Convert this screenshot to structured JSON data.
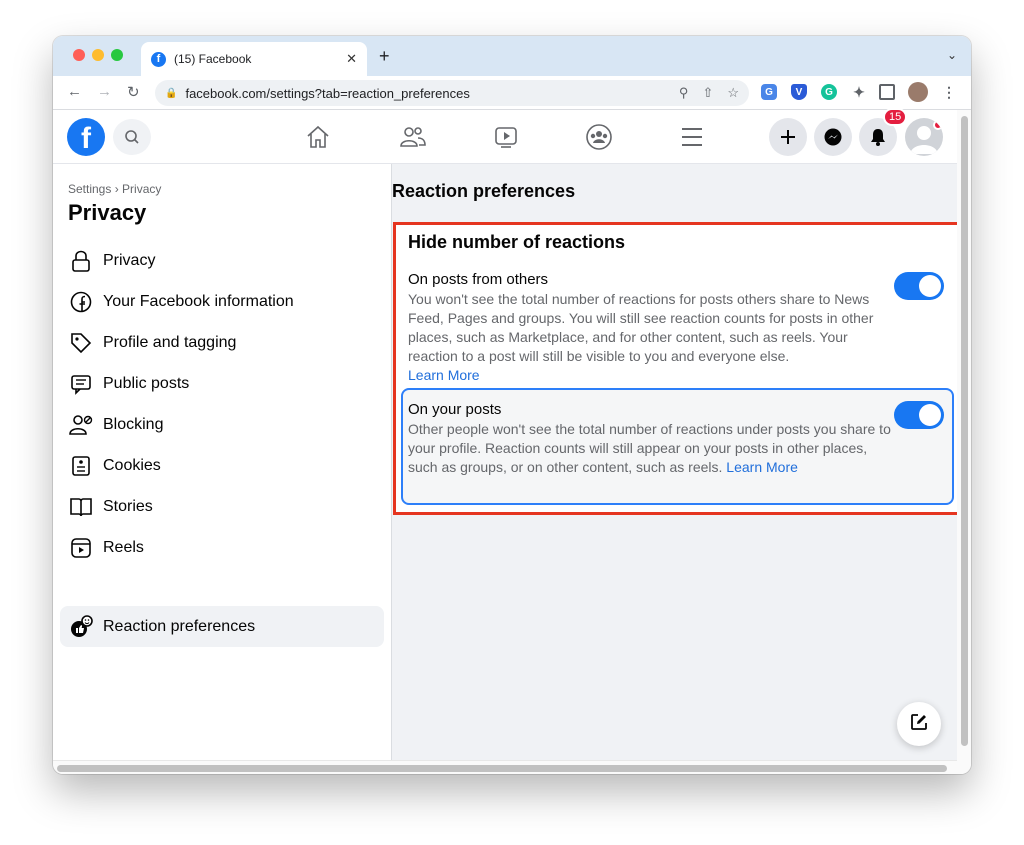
{
  "browser": {
    "tab_title": "(15) Facebook",
    "tab_close": "✕",
    "new_tab": "+",
    "url": "facebook.com/settings?tab=reaction_preferences"
  },
  "header": {
    "logo_letter": "f",
    "notification_count": "15"
  },
  "sidebar": {
    "breadcrumb": "Settings › Privacy",
    "title": "Privacy",
    "items": [
      {
        "label": "Privacy",
        "icon": "lock-icon"
      },
      {
        "label": "Your Facebook information",
        "icon": "facebook-icon"
      },
      {
        "label": "Profile and tagging",
        "icon": "tag-icon"
      },
      {
        "label": "Public posts",
        "icon": "public-posts-icon"
      },
      {
        "label": "Blocking",
        "icon": "blocking-icon"
      },
      {
        "label": "Cookies",
        "icon": "cookies-icon"
      },
      {
        "label": "Stories",
        "icon": "stories-icon"
      },
      {
        "label": "Reels",
        "icon": "reels-icon"
      },
      {
        "label": "Reaction preferences",
        "icon": "reaction-icon",
        "active": true
      }
    ]
  },
  "main": {
    "title": "Reaction preferences",
    "section_title": "Hide number of reactions",
    "options": [
      {
        "heading": "On posts from others",
        "description": "You won't see the total number of reactions for posts others share to News Feed, Pages and groups. You will still see reaction counts for posts in other places, such as Marketplace, and for other content, such as reels. Your reaction to a post will still be visible to you and everyone else.",
        "link": "Learn More",
        "enabled": true
      },
      {
        "heading": "On your posts",
        "description": "Other people won't see the total number of reactions under posts you share to your profile. Reaction counts will still appear on your posts in other places, such as groups, or on other content, such as reels.",
        "link": "Learn More",
        "enabled": true
      }
    ]
  },
  "colors": {
    "accent": "#1877f2",
    "highlight_box": "#e53520",
    "selected_border": "#2d7ff9"
  }
}
